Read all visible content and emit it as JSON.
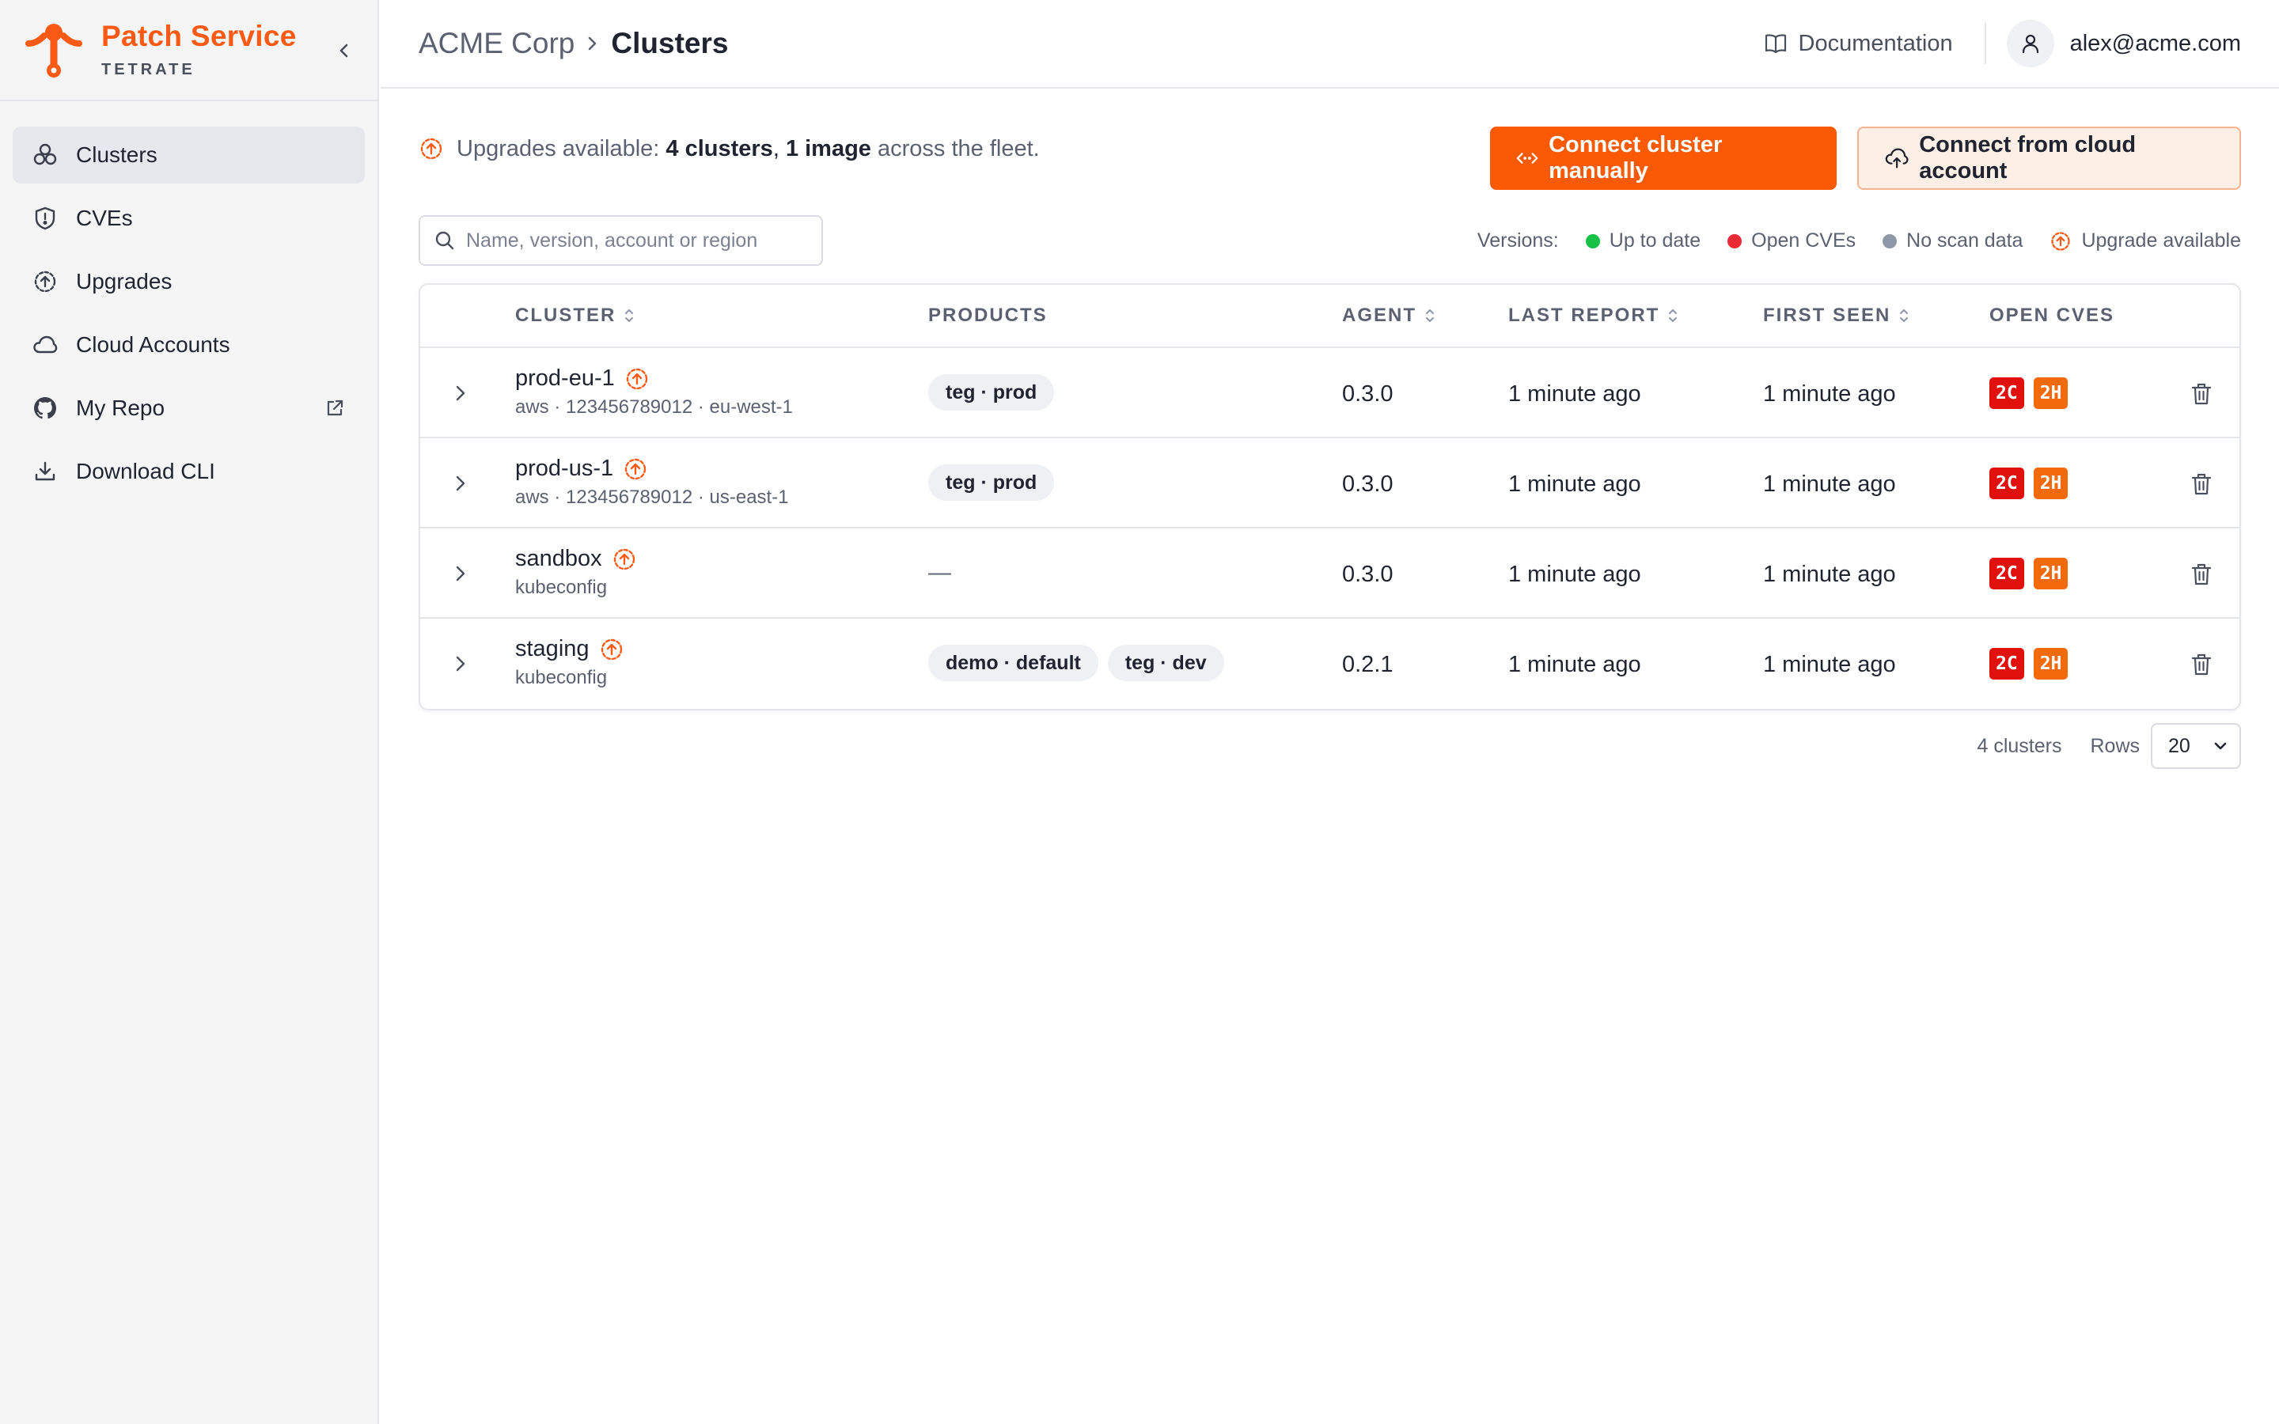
{
  "brand": {
    "name": "Patch Service",
    "sub": "TETRATE",
    "accent": "#fa5a14"
  },
  "sidebar": {
    "items": [
      {
        "label": "Clusters",
        "icon": "clusters-icon",
        "active": true
      },
      {
        "label": "CVEs",
        "icon": "shield-icon"
      },
      {
        "label": "Upgrades",
        "icon": "upgrade-icon"
      },
      {
        "label": "Cloud Accounts",
        "icon": "cloud-icon"
      },
      {
        "label": "My Repo",
        "icon": "github-icon",
        "external": true
      },
      {
        "label": "Download CLI",
        "icon": "download-icon"
      }
    ]
  },
  "header": {
    "breadcrumb_parent": "ACME Corp",
    "breadcrumb_current": "Clusters",
    "docs_label": "Documentation",
    "user_email": "alex@acme.com"
  },
  "upgrades_note": {
    "prefix": "Upgrades available: ",
    "clusters": "4 clusters",
    "comma": ", ",
    "images": "1 image",
    "suffix": " across the fleet."
  },
  "actions": {
    "connect_manual": "Connect cluster manually",
    "connect_cloud": "Connect from cloud account"
  },
  "search": {
    "placeholder": "Name, version, account or region",
    "value": ""
  },
  "legend": {
    "label": "Versions:",
    "items": [
      {
        "label": "Up to date",
        "color": "#16c146"
      },
      {
        "label": "Open CVEs",
        "color": "#ea2a35"
      },
      {
        "label": "No scan data",
        "color": "#8e97a8"
      },
      {
        "label": "Upgrade available",
        "color": "#fa5a14"
      }
    ]
  },
  "table": {
    "columns": [
      "CLUSTER",
      "PRODUCTS",
      "AGENT",
      "LAST REPORT",
      "FIRST SEEN",
      "OPEN CVES"
    ],
    "rows": [
      {
        "name": "prod-eu-1",
        "sub": "aws · 123456789012 · eu-west-1",
        "products": [
          "teg · prod"
        ],
        "agent": "0.3.0",
        "last_report": "1 minute ago",
        "first_seen": "1 minute ago",
        "cves": [
          "2C",
          "2H"
        ]
      },
      {
        "name": "prod-us-1",
        "sub": "aws · 123456789012 · us-east-1",
        "products": [
          "teg · prod"
        ],
        "agent": "0.3.0",
        "last_report": "1 minute ago",
        "first_seen": "1 minute ago",
        "cves": [
          "2C",
          "2H"
        ]
      },
      {
        "name": "sandbox",
        "sub": "kubeconfig",
        "products": [],
        "products_empty": "—",
        "agent": "0.3.0",
        "last_report": "1 minute ago",
        "first_seen": "1 minute ago",
        "cves": [
          "2C",
          "2H"
        ]
      },
      {
        "name": "staging",
        "sub": "kubeconfig",
        "products": [
          "demo · default",
          "teg · dev"
        ],
        "agent": "0.2.1",
        "last_report": "1 minute ago",
        "first_seen": "1 minute ago",
        "cves": [
          "2C",
          "2H"
        ]
      }
    ]
  },
  "pager": {
    "count": "4 clusters",
    "rows_label": "Rows",
    "rows_value": "20"
  },
  "colors": {
    "primary": "#fa5a05",
    "critical": "#e0110d",
    "high": "#f26a0b"
  }
}
